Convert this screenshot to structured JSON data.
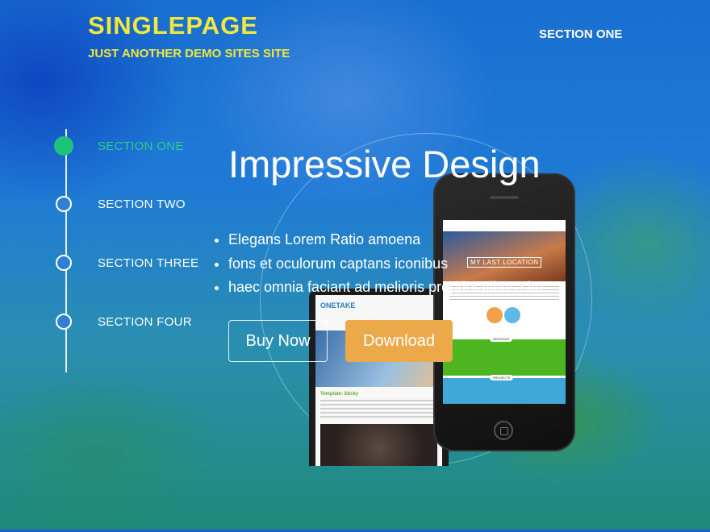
{
  "header": {
    "site_title": "SINGLEPAGE",
    "tagline": "JUST ANOTHER DEMO SITES SITE",
    "nav_link": "SECTION ONE"
  },
  "timeline": {
    "items": [
      {
        "label": "SECTION ONE",
        "active": true
      },
      {
        "label": "SECTION TWO",
        "active": false
      },
      {
        "label": "SECTION THREE",
        "active": false
      },
      {
        "label": "SECTION FOUR",
        "active": false
      }
    ]
  },
  "hero": {
    "title": "Impressive Design",
    "features": [
      "Elegans Lorem Ratio amoena",
      "fons et oculorum captans iconibus",
      "haec omnia faciant ad melioris proprietatibus site"
    ],
    "buy_label": "Buy Now",
    "download_label": "Download"
  },
  "mockup": {
    "tablet_logo": "ONETAKE",
    "tablet_post_title": "Template: Sticky",
    "phone_hero_text": "MY LAST LOCATION",
    "phone_services_label": "SERVICES",
    "phone_projects_label": "PROJECTS"
  },
  "colors": {
    "title_yellow": "#f0e83a",
    "active_green": "#1fc27a",
    "download_orange": "#eca94a"
  }
}
